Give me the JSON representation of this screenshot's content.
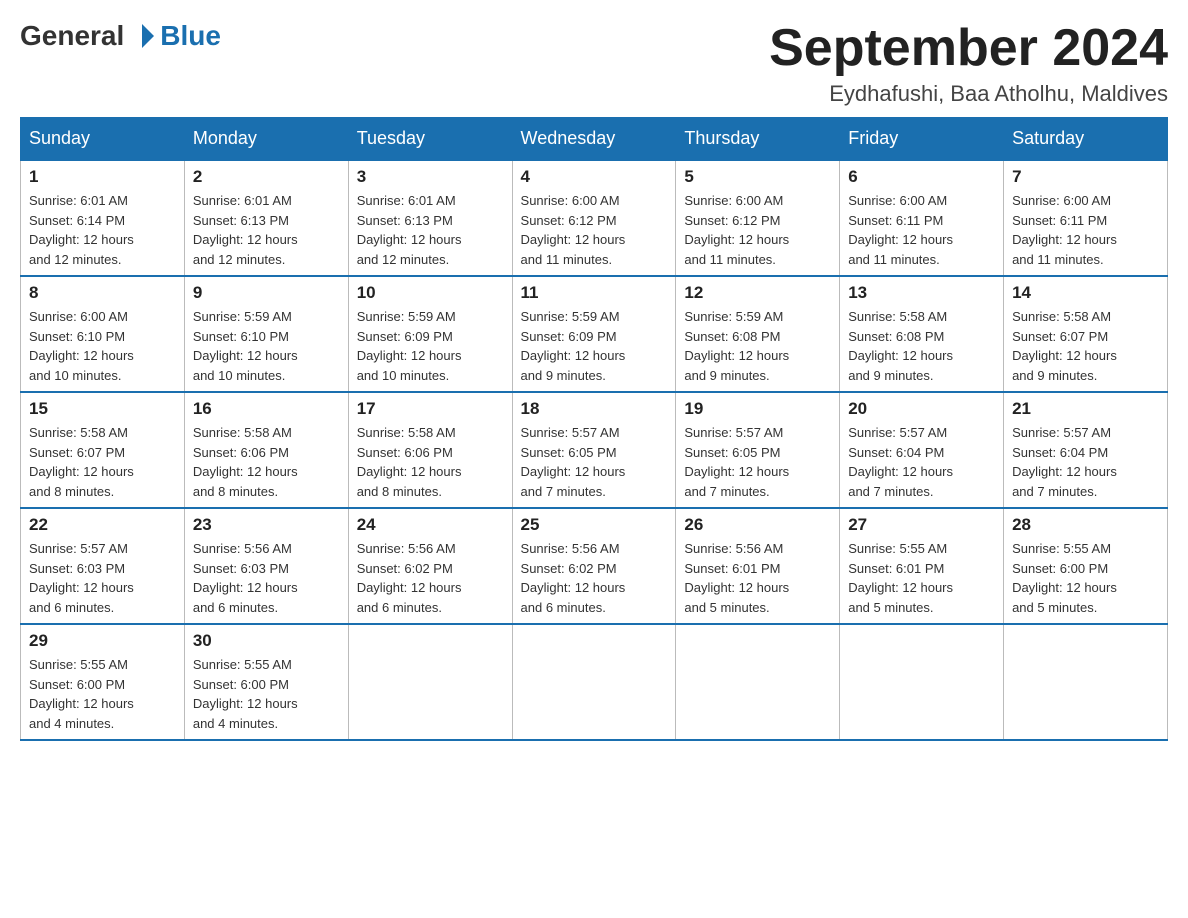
{
  "logo": {
    "text_general": "General",
    "text_blue": "Blue"
  },
  "title": "September 2024",
  "location": "Eydhafushi, Baa Atholhu, Maldives",
  "days_of_week": [
    "Sunday",
    "Monday",
    "Tuesday",
    "Wednesday",
    "Thursday",
    "Friday",
    "Saturday"
  ],
  "weeks": [
    [
      {
        "day": "1",
        "sunrise": "6:01 AM",
        "sunset": "6:14 PM",
        "daylight": "12 hours and 12 minutes."
      },
      {
        "day": "2",
        "sunrise": "6:01 AM",
        "sunset": "6:13 PM",
        "daylight": "12 hours and 12 minutes."
      },
      {
        "day": "3",
        "sunrise": "6:01 AM",
        "sunset": "6:13 PM",
        "daylight": "12 hours and 12 minutes."
      },
      {
        "day": "4",
        "sunrise": "6:00 AM",
        "sunset": "6:12 PM",
        "daylight": "12 hours and 11 minutes."
      },
      {
        "day": "5",
        "sunrise": "6:00 AM",
        "sunset": "6:12 PM",
        "daylight": "12 hours and 11 minutes."
      },
      {
        "day": "6",
        "sunrise": "6:00 AM",
        "sunset": "6:11 PM",
        "daylight": "12 hours and 11 minutes."
      },
      {
        "day": "7",
        "sunrise": "6:00 AM",
        "sunset": "6:11 PM",
        "daylight": "12 hours and 11 minutes."
      }
    ],
    [
      {
        "day": "8",
        "sunrise": "6:00 AM",
        "sunset": "6:10 PM",
        "daylight": "12 hours and 10 minutes."
      },
      {
        "day": "9",
        "sunrise": "5:59 AM",
        "sunset": "6:10 PM",
        "daylight": "12 hours and 10 minutes."
      },
      {
        "day": "10",
        "sunrise": "5:59 AM",
        "sunset": "6:09 PM",
        "daylight": "12 hours and 10 minutes."
      },
      {
        "day": "11",
        "sunrise": "5:59 AM",
        "sunset": "6:09 PM",
        "daylight": "12 hours and 9 minutes."
      },
      {
        "day": "12",
        "sunrise": "5:59 AM",
        "sunset": "6:08 PM",
        "daylight": "12 hours and 9 minutes."
      },
      {
        "day": "13",
        "sunrise": "5:58 AM",
        "sunset": "6:08 PM",
        "daylight": "12 hours and 9 minutes."
      },
      {
        "day": "14",
        "sunrise": "5:58 AM",
        "sunset": "6:07 PM",
        "daylight": "12 hours and 9 minutes."
      }
    ],
    [
      {
        "day": "15",
        "sunrise": "5:58 AM",
        "sunset": "6:07 PM",
        "daylight": "12 hours and 8 minutes."
      },
      {
        "day": "16",
        "sunrise": "5:58 AM",
        "sunset": "6:06 PM",
        "daylight": "12 hours and 8 minutes."
      },
      {
        "day": "17",
        "sunrise": "5:58 AM",
        "sunset": "6:06 PM",
        "daylight": "12 hours and 8 minutes."
      },
      {
        "day": "18",
        "sunrise": "5:57 AM",
        "sunset": "6:05 PM",
        "daylight": "12 hours and 7 minutes."
      },
      {
        "day": "19",
        "sunrise": "5:57 AM",
        "sunset": "6:05 PM",
        "daylight": "12 hours and 7 minutes."
      },
      {
        "day": "20",
        "sunrise": "5:57 AM",
        "sunset": "6:04 PM",
        "daylight": "12 hours and 7 minutes."
      },
      {
        "day": "21",
        "sunrise": "5:57 AM",
        "sunset": "6:04 PM",
        "daylight": "12 hours and 7 minutes."
      }
    ],
    [
      {
        "day": "22",
        "sunrise": "5:57 AM",
        "sunset": "6:03 PM",
        "daylight": "12 hours and 6 minutes."
      },
      {
        "day": "23",
        "sunrise": "5:56 AM",
        "sunset": "6:03 PM",
        "daylight": "12 hours and 6 minutes."
      },
      {
        "day": "24",
        "sunrise": "5:56 AM",
        "sunset": "6:02 PM",
        "daylight": "12 hours and 6 minutes."
      },
      {
        "day": "25",
        "sunrise": "5:56 AM",
        "sunset": "6:02 PM",
        "daylight": "12 hours and 6 minutes."
      },
      {
        "day": "26",
        "sunrise": "5:56 AM",
        "sunset": "6:01 PM",
        "daylight": "12 hours and 5 minutes."
      },
      {
        "day": "27",
        "sunrise": "5:55 AM",
        "sunset": "6:01 PM",
        "daylight": "12 hours and 5 minutes."
      },
      {
        "day": "28",
        "sunrise": "5:55 AM",
        "sunset": "6:00 PM",
        "daylight": "12 hours and 5 minutes."
      }
    ],
    [
      {
        "day": "29",
        "sunrise": "5:55 AM",
        "sunset": "6:00 PM",
        "daylight": "12 hours and 4 minutes."
      },
      {
        "day": "30",
        "sunrise": "5:55 AM",
        "sunset": "6:00 PM",
        "daylight": "12 hours and 4 minutes."
      },
      null,
      null,
      null,
      null,
      null
    ]
  ],
  "labels": {
    "sunrise": "Sunrise:",
    "sunset": "Sunset:",
    "daylight": "Daylight:"
  }
}
